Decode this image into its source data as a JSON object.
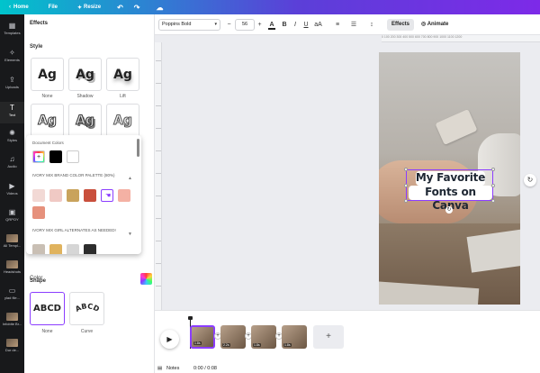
{
  "topbar": {
    "home": "Home",
    "file": "File",
    "resize": "Resize",
    "undo_icon": "↶",
    "redo_icon": "↷",
    "cloud_icon": "☁"
  },
  "rail": [
    {
      "label": "Templates",
      "icon": "▦"
    },
    {
      "label": "Elements",
      "icon": "✧"
    },
    {
      "label": "Uploads",
      "icon": "⇪"
    },
    {
      "label": "Text",
      "icon": "T"
    },
    {
      "label": "Styles",
      "icon": "✺"
    },
    {
      "label": "Audio",
      "icon": "♫"
    },
    {
      "label": "Videos",
      "icon": "▶"
    },
    {
      "label": "QRPOY",
      "icon": "▣"
    },
    {
      "label": "All Templ...",
      "icon": ""
    },
    {
      "label": "Headshots",
      "icon": ""
    },
    {
      "label": "ylad file...",
      "icon": "▭"
    },
    {
      "label": "Infobite Br...",
      "icon": ""
    },
    {
      "label": "Dur de...",
      "icon": ""
    }
  ],
  "panel": {
    "title": "Effects",
    "style_heading": "Style",
    "style_tiles": [
      {
        "sample": "Ag",
        "label": "None"
      },
      {
        "sample": "Ag",
        "label": "Shadow"
      },
      {
        "sample": "Ag",
        "label": "Lift"
      },
      {
        "sample": "Ag",
        "label": ""
      },
      {
        "sample": "Ag",
        "label": ""
      },
      {
        "sample": "Ag",
        "label": ""
      }
    ],
    "color_label": "Color",
    "shape_heading": "Shape",
    "shape_tiles": [
      {
        "sample": "ABCD",
        "label": "None"
      },
      {
        "sample": "ABCD",
        "label": "Curve"
      }
    ]
  },
  "color_popup": {
    "document_colors_heading": "Document Colors",
    "document_colors": [
      "#000000",
      "#ffffff"
    ],
    "palette1_heading": "IVORY MIX BRAND COLOR PALETTE (80%)",
    "palette1_colors": [
      "#f2d9d5",
      "#f0c9c4",
      "#c9a35c",
      "#c94f3c",
      "#ffffff",
      "#f4b1a4",
      "#e6917c"
    ],
    "palette2_heading": "IVORY MIX GIRL ALTERNATES AS NEEDED!",
    "palette2_colors": [
      "#c9bfb4",
      "#e0b35e",
      "#d6d6d6",
      "#2d2d2d"
    ]
  },
  "toolbar": {
    "font": "Poppins Bold",
    "minus": "−",
    "size": "56",
    "plus": "+",
    "bold": "B",
    "italic": "I",
    "underline": "U",
    "case": "aA",
    "align": "≡",
    "list": "☰",
    "spacing": "↕",
    "effects": "Effects",
    "animate": "Animate"
  },
  "ruler_marks": "0 100 200 300 400 500 600 700 800 900 1000 1100 1200",
  "canvas": {
    "headline_line1": "My Favorite",
    "headline_line2": "Fonts on Canva"
  },
  "timeline": {
    "clips": [
      {
        "duration": "1.8s"
      },
      {
        "duration": "2.2s"
      },
      {
        "duration": "1.8s"
      },
      {
        "duration": "1.8s"
      }
    ],
    "add": "+"
  },
  "bottombar": {
    "notes": "Notes",
    "time": "0:00 / 0:08"
  }
}
